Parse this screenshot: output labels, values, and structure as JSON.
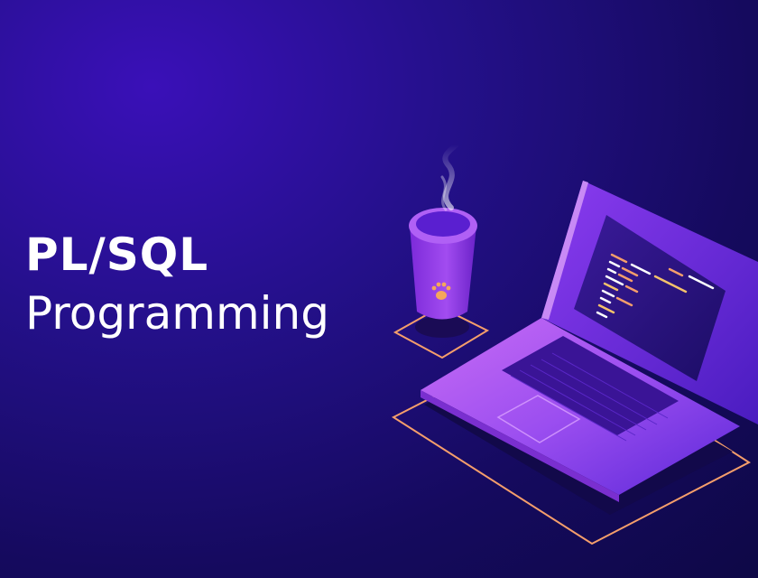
{
  "banner": {
    "title_line_1": "PL/SQL",
    "title_line_2": "Programming"
  },
  "illustration": {
    "laptop_icon": "laptop-icon",
    "cup_icon": "coffee-cup-icon",
    "paw_icon": "paw-print-icon"
  },
  "colors": {
    "background_dark": "#0e0846",
    "background_light": "#3a10b8",
    "accent_purple": "#a855f7",
    "accent_orange": "#f59e6b",
    "text": "#ffffff"
  }
}
